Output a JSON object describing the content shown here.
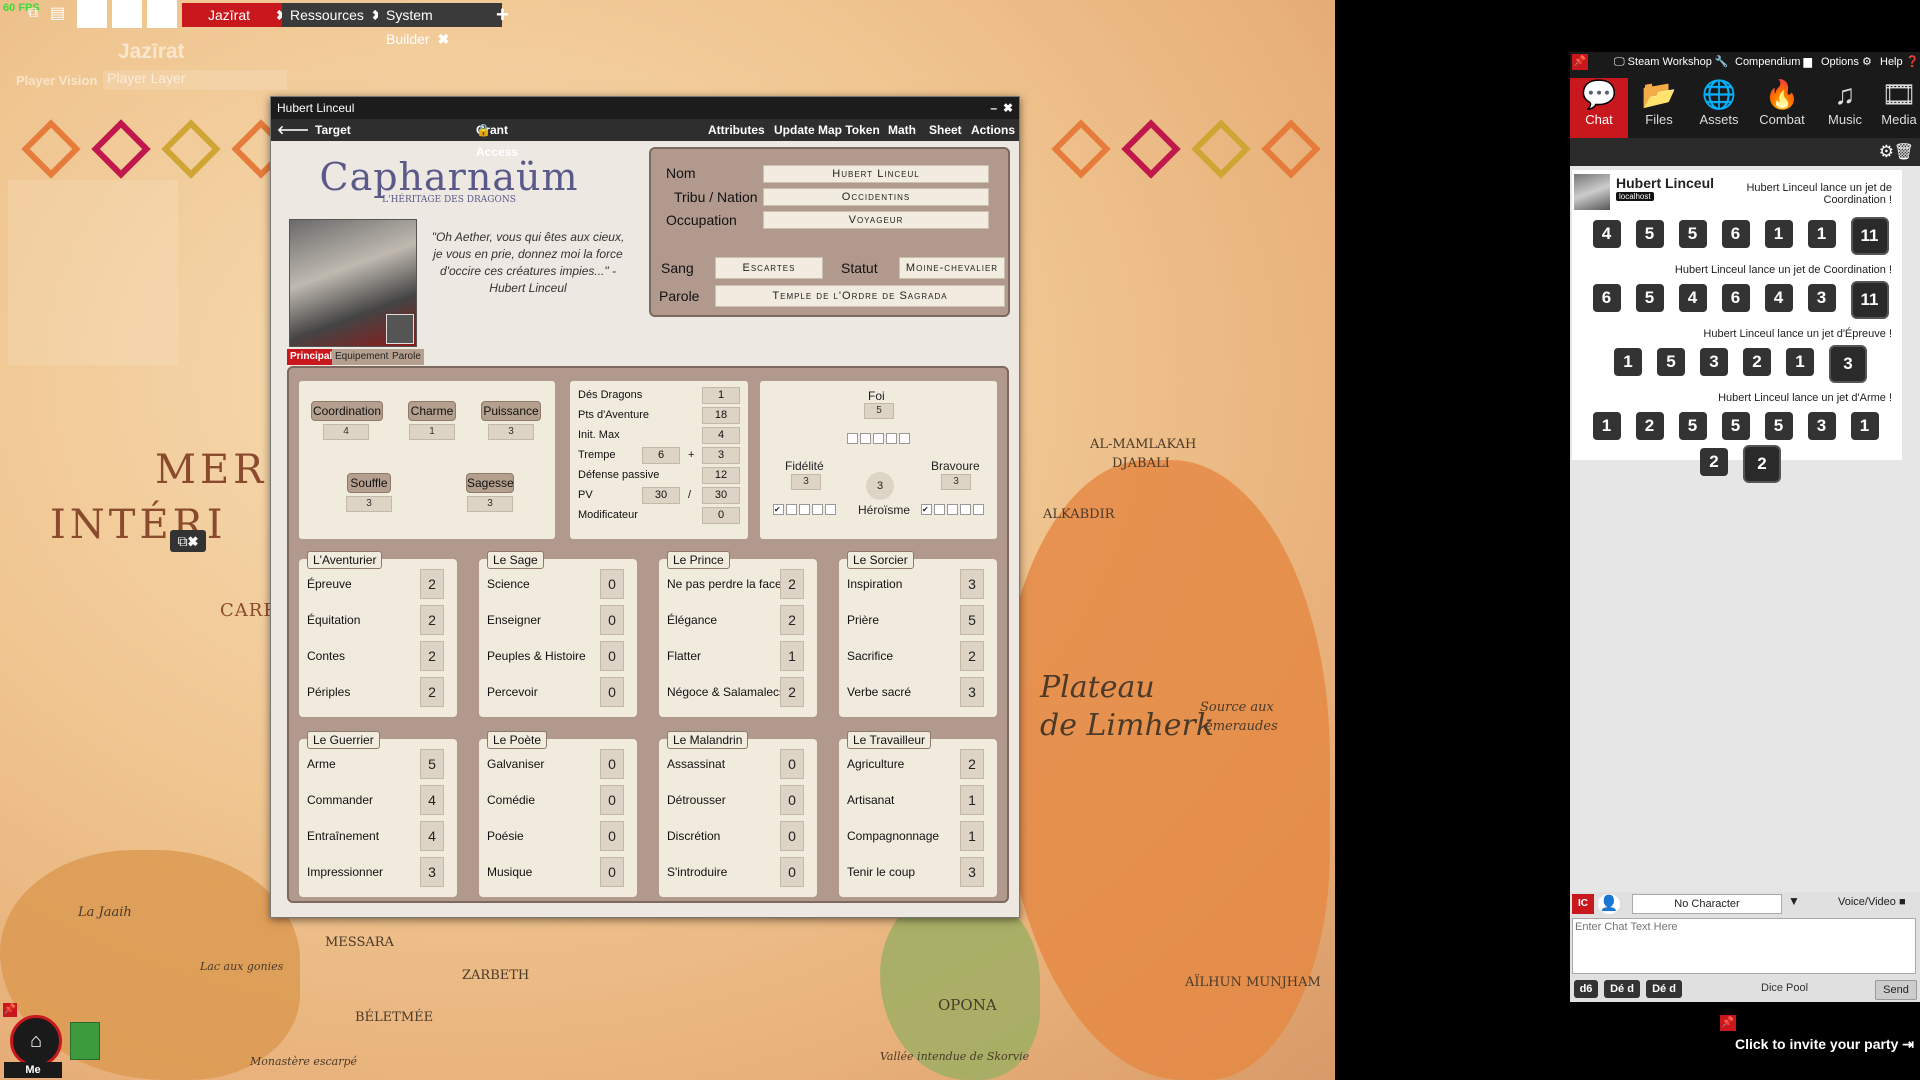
{
  "app": {
    "fps": "60 FPS"
  },
  "tabs": [
    {
      "label": "Jazīrat",
      "active": true
    },
    {
      "label": "Ressources",
      "active": false
    },
    {
      "label": "System Builder",
      "active": false
    }
  ],
  "map": {
    "title": "Jazīrat",
    "player_vision": "Player Vision",
    "player_layer": "Player Layer",
    "labels": {
      "mer": "MER",
      "interieure": "INTÉRI",
      "carr": "CARR"
    },
    "places": {
      "al_mamlakah": "AL-MAMLAKAH",
      "djabali": "DJABALI",
      "alkabdir": "ALKABDIR",
      "plateau": "Plateau",
      "limherk": "de Limherk",
      "source": "Source aux",
      "emeraudes": "émeraudes",
      "messara": "MESSARA",
      "zarbeth": "ZARBETH",
      "beletmee": "BÉLETMÉE",
      "opona": "OPONA",
      "ailhun": "AÏLHUN MUNJHAM",
      "la_jaaih": "La Jaaih",
      "lac_aux_gonies": "Lac aux gonies",
      "monastere": "Monastère escarpé",
      "vallee": "Vallée intendue de Skorvie"
    },
    "me_label": "Me"
  },
  "sheet": {
    "title": "Hubert Linceul",
    "toolbar": {
      "target": "Target",
      "grant_access": "Grant Access",
      "attributes": "Attributes",
      "update_token": "Update Map Token",
      "math": "Math",
      "sheet": "Sheet",
      "actions": "Actions"
    },
    "logo_title": "Capharnaüm",
    "logo_subtitle": "L'HÉRITAGE DES DRAGONS",
    "quote": "\"Oh Aether, vous qui êtes aux cieux, je vous en prie, donnez moi la force d'occire ces créatures impies...\" - Hubert Linceul",
    "identity": {
      "nom_label": "Nom",
      "nom": "Hubert Linceul",
      "tribu_label": "Tribu / Nation",
      "tribu": "Occidentins",
      "occupation_label": "Occupation",
      "occupation": "Voyageur",
      "sang_label": "Sang",
      "sang": "Escartes",
      "statut_label": "Statut",
      "statut": "Moine-chevalier",
      "parole_label": "Parole",
      "parole": "Temple de l'Ordre de Sagrada"
    },
    "subtabs": [
      "Principal",
      "Equipement",
      "Parole"
    ],
    "attributes": [
      {
        "name": "Coordination",
        "value": "4"
      },
      {
        "name": "Charme",
        "value": "1"
      },
      {
        "name": "Puissance",
        "value": "3"
      },
      {
        "name": "Souffle",
        "value": "3"
      },
      {
        "name": "Sagesse",
        "value": "3"
      }
    ],
    "stats": {
      "des_dragons_label": "Dés Dragons",
      "des_dragons": "1",
      "pts_aventure_label": "Pts d'Aventure",
      "pts_aventure": "18",
      "init_max_label": "Init. Max",
      "init_max": "4",
      "trempe_label": "Trempe",
      "trempe_a": "6",
      "plus": "+",
      "trempe_b": "3",
      "defense_label": "Défense passive",
      "defense": "12",
      "pv_label": "PV",
      "pv_cur": "30",
      "slash": "/",
      "pv_max": "30",
      "modif_label": "Modificateur",
      "modif": "0"
    },
    "virtues": {
      "foi_label": "Foi",
      "foi": "5",
      "fidelite_label": "Fidélité",
      "fidelite": "3",
      "heroisme_label": "Héroïsme",
      "heroisme": "3",
      "bravoure_label": "Bravoure",
      "bravoure": "3"
    },
    "skill_groups": [
      {
        "title": "L'Aventurier",
        "skills": [
          {
            "n": "Épreuve",
            "v": "2"
          },
          {
            "n": "Équitation",
            "v": "2"
          },
          {
            "n": "Contes",
            "v": "2"
          },
          {
            "n": "Périples",
            "v": "2"
          }
        ]
      },
      {
        "title": "Le Sage",
        "skills": [
          {
            "n": "Science",
            "v": "0"
          },
          {
            "n": "Enseigner",
            "v": "0"
          },
          {
            "n": "Peuples & Histoire",
            "v": "0"
          },
          {
            "n": "Percevoir",
            "v": "0"
          }
        ]
      },
      {
        "title": "Le Prince",
        "skills": [
          {
            "n": "Ne pas perdre la face",
            "v": "2"
          },
          {
            "n": "Élégance",
            "v": "2"
          },
          {
            "n": "Flatter",
            "v": "1"
          },
          {
            "n": "Négoce & Salamalecs",
            "v": "2"
          }
        ]
      },
      {
        "title": "Le Sorcier",
        "skills": [
          {
            "n": "Inspiration",
            "v": "3"
          },
          {
            "n": "Prière",
            "v": "5"
          },
          {
            "n": "Sacrifice",
            "v": "2"
          },
          {
            "n": "Verbe sacré",
            "v": "3"
          }
        ]
      },
      {
        "title": "Le Guerrier",
        "skills": [
          {
            "n": "Arme",
            "v": "5"
          },
          {
            "n": "Commander",
            "v": "4"
          },
          {
            "n": "Entraînement",
            "v": "4"
          },
          {
            "n": "Impressionner",
            "v": "3"
          }
        ]
      },
      {
        "title": "Le Poète",
        "skills": [
          {
            "n": "Galvaniser",
            "v": "0"
          },
          {
            "n": "Comédie",
            "v": "0"
          },
          {
            "n": "Poésie",
            "v": "0"
          },
          {
            "n": "Musique",
            "v": "0"
          }
        ]
      },
      {
        "title": "Le Malandrin",
        "skills": [
          {
            "n": "Assassinat",
            "v": "0"
          },
          {
            "n": "Détrousser",
            "v": "0"
          },
          {
            "n": "Discrétion",
            "v": "0"
          },
          {
            "n": "S'introduire",
            "v": "0"
          }
        ]
      },
      {
        "title": "Le Travailleur",
        "skills": [
          {
            "n": "Agriculture",
            "v": "2"
          },
          {
            "n": "Artisanat",
            "v": "1"
          },
          {
            "n": "Compagnonnage",
            "v": "1"
          },
          {
            "n": "Tenir le coup",
            "v": "3"
          }
        ]
      }
    ]
  },
  "panel": {
    "top_links": {
      "steam": "Steam Workshop",
      "compendium": "Compendium",
      "options": "Options",
      "help": "Help"
    },
    "icons": [
      {
        "label": "Chat",
        "icon": "chat-icon",
        "active": true
      },
      {
        "label": "Files",
        "icon": "folder-icon"
      },
      {
        "label": "Assets",
        "icon": "globe-icon"
      },
      {
        "label": "Combat",
        "icon": "flame-icon"
      },
      {
        "label": "Music",
        "icon": "music-icon"
      },
      {
        "label": "Media",
        "icon": "film-icon"
      }
    ],
    "chat": {
      "sender": "Hubert Linceul",
      "host_badge": "localhost",
      "rolls": [
        {
          "msg": "Hubert Linceul lance un jet de Coordination !",
          "dice": [
            "4",
            "5",
            "5",
            "6",
            "1",
            "1"
          ],
          "total": "11"
        },
        {
          "msg": "Hubert Linceul lance un jet de Coordination !",
          "dice": [
            "6",
            "5",
            "4",
            "6",
            "4",
            "3"
          ],
          "total": "11"
        },
        {
          "msg": "Hubert Linceul lance un jet d'Épreuve !",
          "dice": [
            "1",
            "5",
            "3",
            "2",
            "1"
          ],
          "total": "3"
        },
        {
          "msg": "Hubert Linceul lance un jet d'Arme !",
          "dice": [
            "1",
            "2",
            "5",
            "5",
            "5",
            "3",
            "1",
            "2"
          ],
          "total": "2"
        }
      ]
    },
    "input": {
      "ic_badge": "IC",
      "character_select": "No Character",
      "voice": "Voice/Video",
      "placeholder": "Enter Chat Text Here",
      "buttons": [
        "d6",
        "Dé d",
        "Dé d"
      ],
      "dice_pool": "Dice Pool",
      "send": "Send"
    },
    "invite": "Click to invite your party"
  },
  "colors": {
    "accent_red": "#c8181e",
    "panel_dark": "#1a1a1a",
    "parchment": "#b19a8d"
  }
}
